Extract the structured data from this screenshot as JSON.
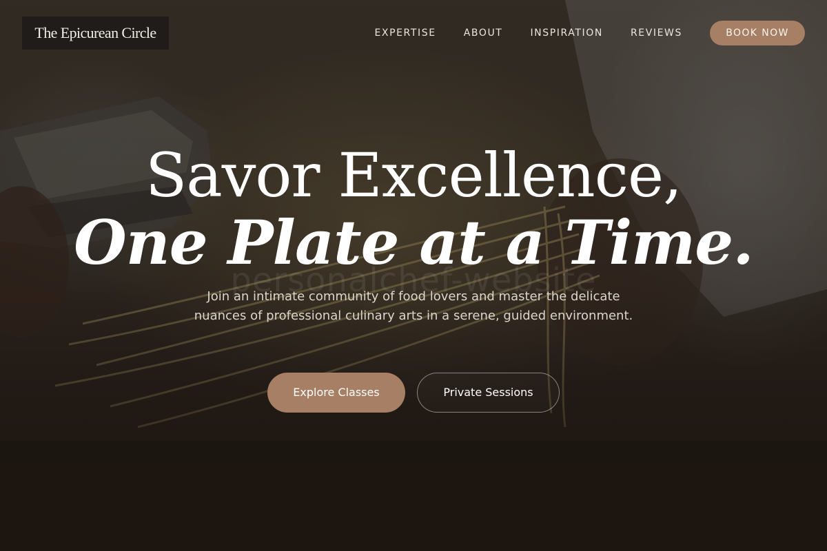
{
  "brand": {
    "name": "The Epicurean Circle"
  },
  "nav": {
    "links": [
      {
        "label": "EXPERTISE"
      },
      {
        "label": "ABOUT"
      },
      {
        "label": "INSPIRATION"
      },
      {
        "label": "REVIEWS"
      }
    ],
    "cta_label": "BOOK NOW"
  },
  "hero": {
    "headline_line1": "Savor Excellence,",
    "headline_line2": "One Plate at a Time.",
    "watermark": "personalchef-website",
    "subtitle": "Join an intimate community of food lovers and master the delicate nuances of professional culinary arts in a serene, guided environment.",
    "primary_button": "Explore Classes",
    "secondary_button": "Private Sessions",
    "background_image": "chef-hands-pasta-photo"
  },
  "colors": {
    "accent": "#a67f64",
    "background_dark": "#1e1712",
    "text_light": "#ffffff"
  }
}
